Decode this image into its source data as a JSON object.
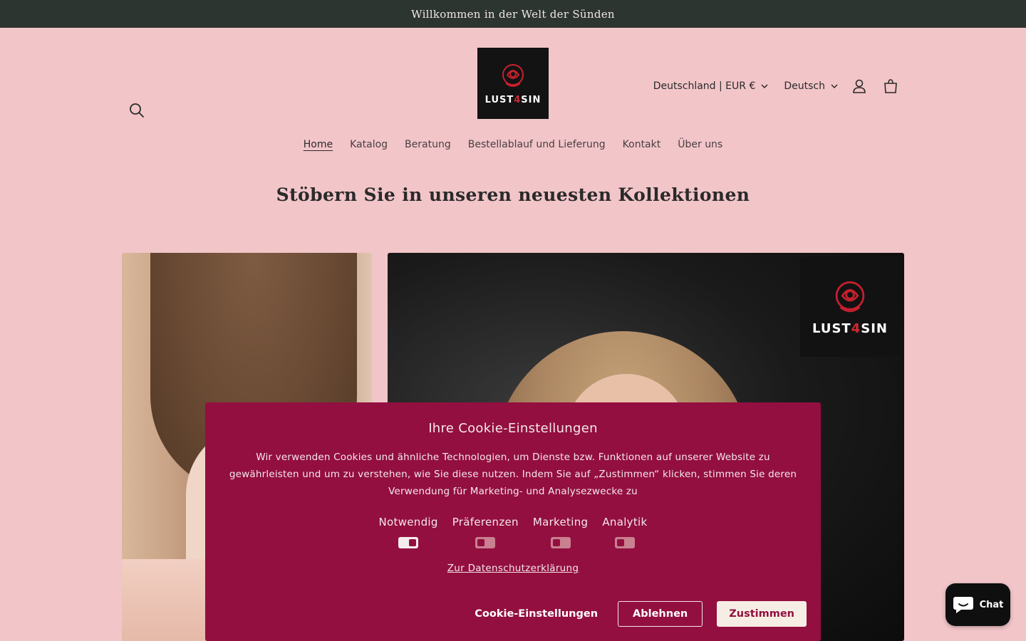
{
  "announcement": "Willkommen in der Welt der Sünden",
  "brand": {
    "logo_prefix": "LUST",
    "logo_four": "4",
    "logo_suffix": "SIN",
    "rose_color": "#c8202e"
  },
  "header": {
    "country_selector": "Deutschland | EUR €",
    "language_selector": "Deutsch",
    "icons": [
      "search-icon",
      "account-icon",
      "cart-icon",
      "chevron-down-icon"
    ]
  },
  "nav": {
    "items": [
      "Home",
      "Katalog",
      "Beratung",
      "Bestellablauf und Lieferung",
      "Kontakt",
      "Über uns"
    ],
    "active": "Home"
  },
  "section_title": "Stöbern Sie in unseren neuesten Kollektionen",
  "cookie": {
    "title": "Ihre Cookie-Einstellungen",
    "text": "Wir verwenden Cookies und ähnliche Technologien, um Dienste bzw. Funktionen auf unserer Website zu gewährleisten und um zu verstehen, wie Sie diese nutzen. Indem Sie auf „Zustimmen“ klicken, stimmen Sie deren Verwendung für Marketing- und Analysezwecke zu",
    "categories": [
      {
        "label": "Notwendig",
        "enabled": true
      },
      {
        "label": "Präferenzen",
        "enabled": false
      },
      {
        "label": "Marketing",
        "enabled": false
      },
      {
        "label": "Analytik",
        "enabled": false
      }
    ],
    "privacy_link": "Zur Datenschutzerklärung",
    "settings_button": "Cookie-Einstellungen",
    "decline_button": "Ablehnen",
    "accept_button": "Zustimmen",
    "background_color": "#930f40"
  },
  "chat": {
    "label": "Chat",
    "icon": "chat-bubble-icon"
  },
  "colors": {
    "page_background": "#f2c5c9",
    "announcement_background": "#2c3530"
  }
}
